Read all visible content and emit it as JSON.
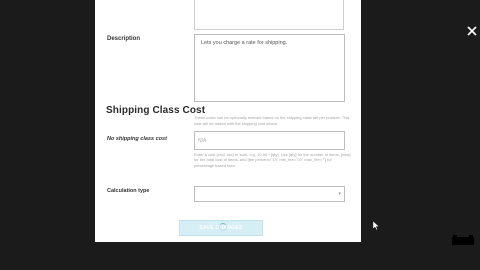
{
  "form": {
    "description_label": "Description",
    "description_value": "Lets you charge a rate for shipping.",
    "section_title": "Shipping Class Cost",
    "section_blurb": "These costs can be optionally entered based on the shipping class set per product. This cost will be added with the shipping cost above.",
    "no_shipping_class_label": "No shipping class cost",
    "no_shipping_class_placeholder": "N/A",
    "help_text": "Enter a cost (excl. tax) or sum, e.g. 10.00 * [qty]. Use [qty] for the number of items, [cost] for the total cost of items, and [fee percent=\"10\" min_fee=\"20\" max_fee=\"\"] for percentage based fees.",
    "calculation_type_label": "Calculation type",
    "calculation_type_value": "",
    "save_button_label": "SAVE CHANGES"
  },
  "icons": {
    "close": "close-icon",
    "cursor": "mouse-cursor-icon",
    "caret": "chevron-down-icon"
  },
  "colors": {
    "overlay": "#1b1b1b",
    "button_disabled": "#d6eef5"
  }
}
